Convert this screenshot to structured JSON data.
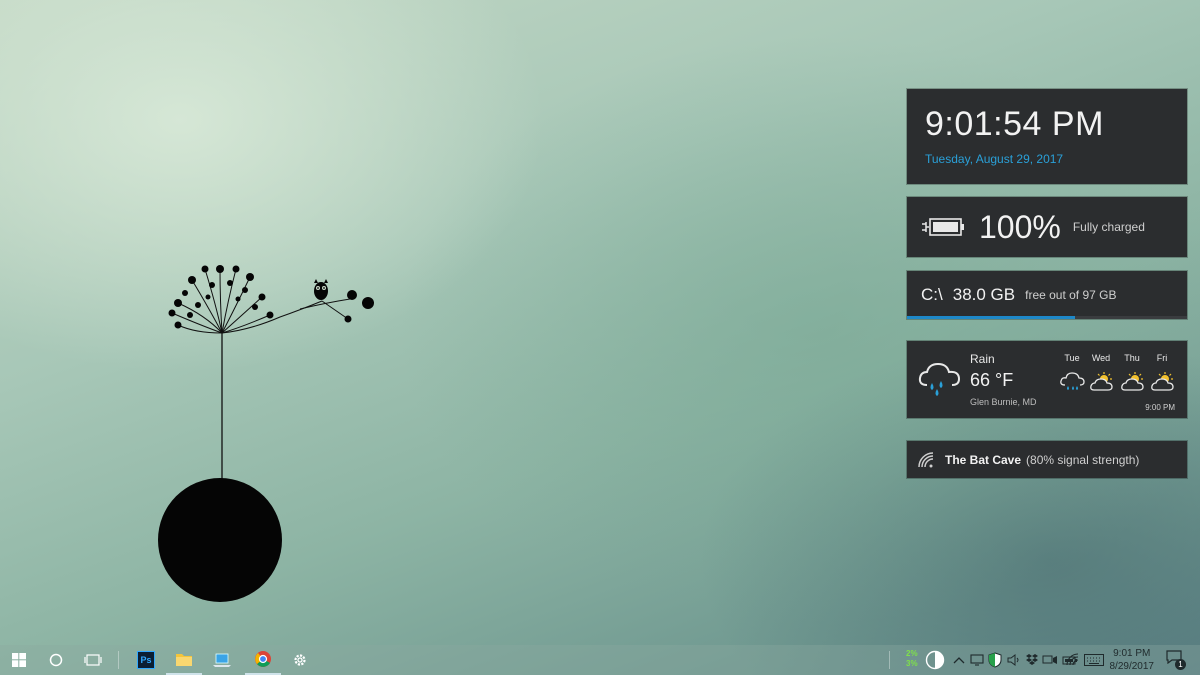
{
  "clock": {
    "time": "9:01:54 PM",
    "date": "Tuesday, August 29, 2017"
  },
  "battery": {
    "percent": "100%",
    "status": "Fully charged"
  },
  "disk": {
    "drive": "C:\\",
    "free_size": "38.0 GB",
    "detail": "free out of 97 GB",
    "used_fraction": 0.6
  },
  "weather": {
    "condition": "Rain",
    "temperature": "66 °F",
    "location": "Glen Burnie, MD",
    "updated": "9:00 PM",
    "forecast": [
      {
        "day": "Tue",
        "icon": "rain-cloud-icon"
      },
      {
        "day": "Wed",
        "icon": "sun-cloud-icon"
      },
      {
        "day": "Thu",
        "icon": "sun-cloud-icon"
      },
      {
        "day": "Fri",
        "icon": "sun-cloud-icon"
      }
    ]
  },
  "wifi": {
    "ssid": "The Bat Cave",
    "signal": "(80% signal strength)"
  },
  "taskbar": {
    "apps": [
      {
        "name": "start-button",
        "icon": "windows-logo-icon"
      },
      {
        "name": "cortana-button",
        "icon": "circle-icon"
      },
      {
        "name": "task-view-button",
        "icon": "task-view-icon"
      },
      {
        "name": "photoshop-app",
        "icon": "photoshop-icon",
        "label": "Ps"
      },
      {
        "name": "file-explorer-app",
        "icon": "folder-icon"
      },
      {
        "name": "this-pc-app",
        "icon": "laptop-icon"
      },
      {
        "name": "chrome-app",
        "icon": "chrome-icon"
      },
      {
        "name": "settings-app",
        "icon": "gear-icon"
      }
    ],
    "tray": {
      "cpu_usage": "2%",
      "mem_usage": "3%",
      "time": "9:01 PM",
      "date": "8/29/2017",
      "notifications": "1"
    }
  },
  "colors": {
    "accent": "#2aa0d8",
    "widget_bg": "#2b2d2f",
    "disk_bar": "#1e88c8",
    "cpu_green": "#7fe04a"
  }
}
